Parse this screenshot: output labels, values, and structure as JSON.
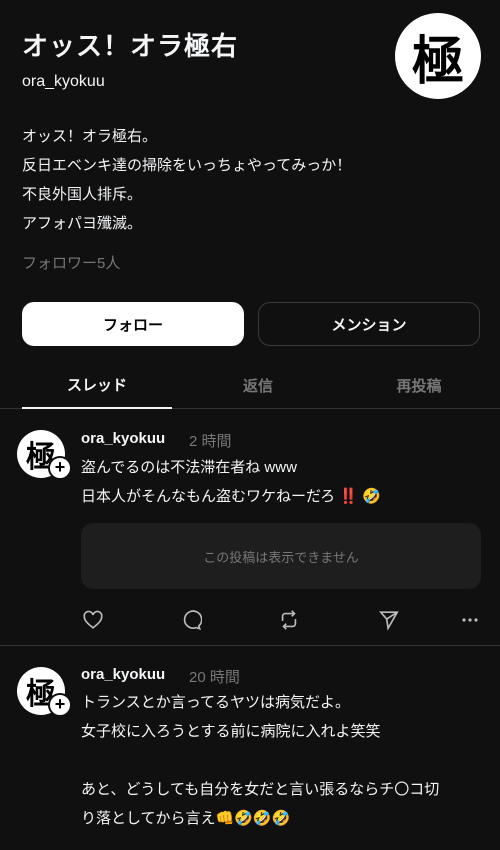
{
  "profile": {
    "name": "オッス！オラ極右",
    "handle": "ora_kyokuu",
    "avatar_char": "極",
    "bio": [
      "オッス！オラ極右。",
      "反日エベンキ達の掃除をいっちょやってみっか！",
      "不良外国人排斥。",
      "アフォパヨ殲滅。"
    ],
    "followers": "フォロワー5人"
  },
  "buttons": {
    "follow": "フォロー",
    "mention": "メンション"
  },
  "tabs": [
    "スレッド",
    "返信",
    "再投稿"
  ],
  "posts": [
    {
      "author": "ora_kyokuu",
      "time": "2 時間",
      "lines": [
        "盗んでるのは不法滞在者ね www",
        "日本人がそんなもん盗むワケねーだろ"
      ],
      "line2_suffix_1": "‼️",
      "line2_suffix_2": "🤣",
      "hidden_notice": "この投稿は表示できません"
    },
    {
      "author": "ora_kyokuu",
      "time": "20 時間",
      "lines": [
        "トランスとか言ってるヤツは病気だよ。",
        "女子校に入ろうとする前に病院に入れよ笑笑",
        "",
        "あと、どうしても自分を女だと言い張るならチ〇コ切",
        "り落としてから言え"
      ],
      "line5_suffix": "👊🤣🤣🤣"
    }
  ],
  "icons": {
    "like": "heart-icon",
    "reply": "comment-icon",
    "repost": "repost-icon",
    "share": "send-icon",
    "more": "more-icon"
  }
}
